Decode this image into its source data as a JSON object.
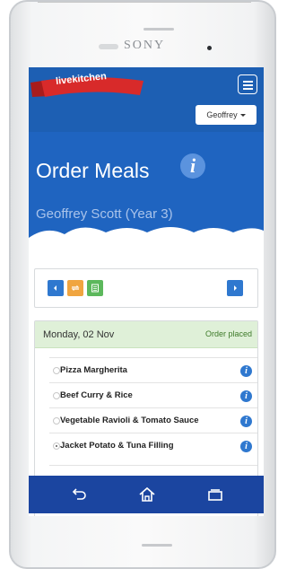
{
  "device": {
    "brand": "SONY"
  },
  "app": {
    "logo_text": "livekitchen",
    "user_button": "Geoffrey",
    "page_title": "Order Meals",
    "subtitle": "Geoffrey Scott (Year 3)"
  },
  "colors": {
    "topbar": "#1d5fb3",
    "hero": "#1f64c0",
    "ribbon": "#d82a2a",
    "nav_blue": "#2f78cf",
    "nav_orange": "#f0a540",
    "nav_green": "#5cb85c",
    "order_placed_bg": "#dff0d8",
    "system_nav": "#1b45a0"
  },
  "toolbar": {
    "buttons": [
      {
        "name": "previous-week-button",
        "icon": "chevron-left-icon"
      },
      {
        "name": "repeat-order-button",
        "icon": "repeat-icon"
      },
      {
        "name": "menu-list-button",
        "icon": "list-icon"
      },
      {
        "name": "next-week-button",
        "icon": "chevron-right-icon"
      }
    ]
  },
  "day": {
    "date": "Monday, 02 Nov",
    "status": "Order placed",
    "meals": [
      {
        "name": "Pizza Margherita",
        "selected": false
      },
      {
        "name": "Beef Curry & Rice",
        "selected": false
      },
      {
        "name": "Vegetable Ravioli & Tomato Sauce",
        "selected": false
      },
      {
        "name": "Jacket Potato & Tuna Filling",
        "selected": true
      }
    ]
  },
  "system_nav": [
    "back-icon",
    "home-icon",
    "recent-apps-icon"
  ]
}
